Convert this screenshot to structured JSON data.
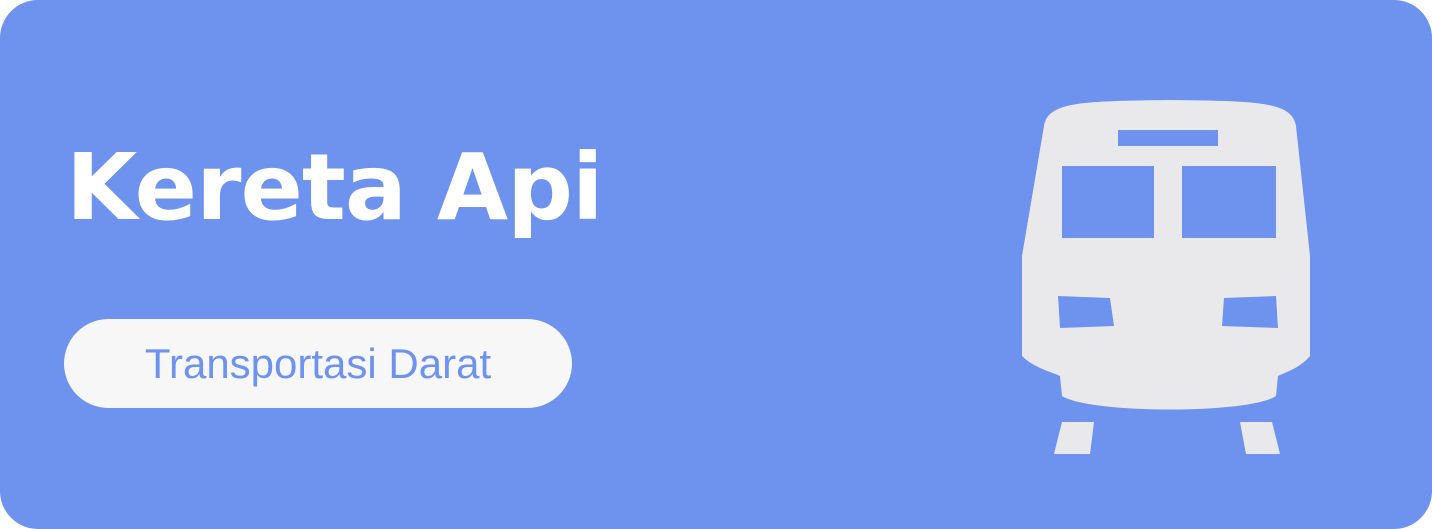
{
  "card": {
    "title": "Kereta Api",
    "category_label": "Transportasi Darat",
    "icon": "train-icon"
  },
  "colors": {
    "card_background": "#6d93ee",
    "title_text": "#ffffff",
    "badge_background": "#f7f7f7",
    "badge_text": "#6d93ee",
    "icon_fill": "#e9e9ec"
  }
}
